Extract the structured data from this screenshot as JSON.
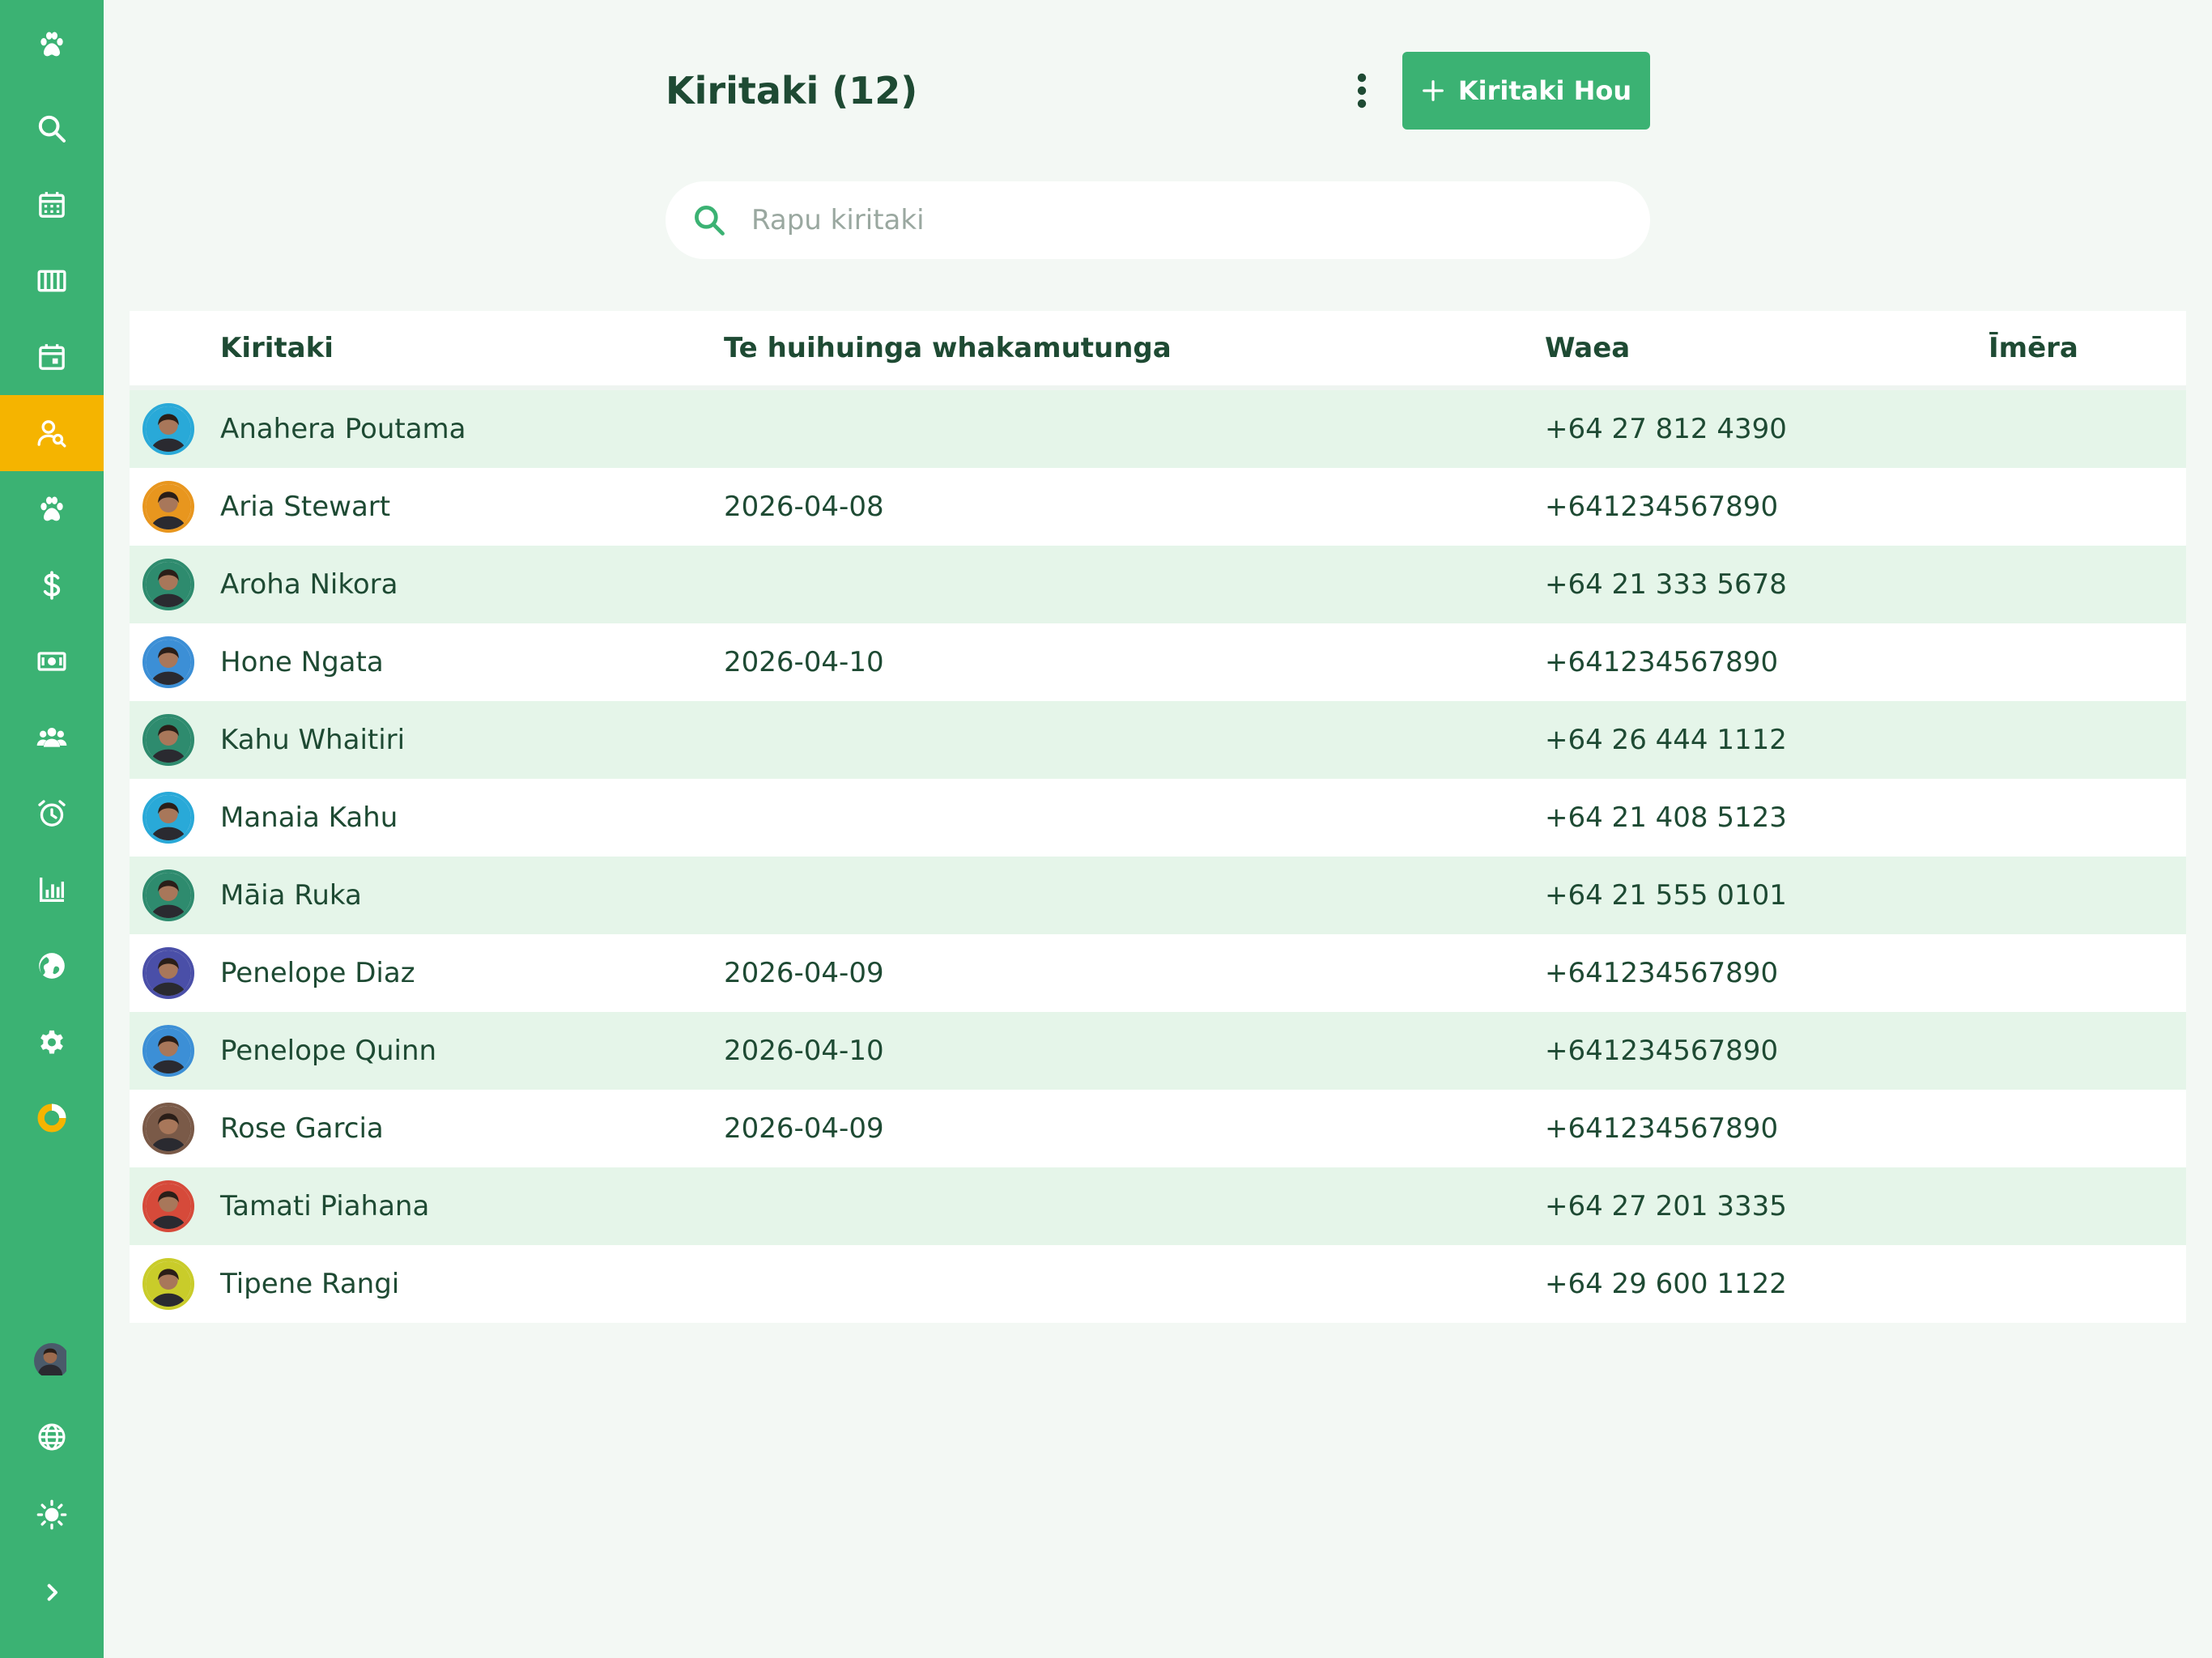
{
  "sidebar": {
    "items": [
      {
        "icon": "paw-icon"
      },
      {
        "icon": "search-icon"
      },
      {
        "icon": "calendar-grid-icon"
      },
      {
        "icon": "columns-icon"
      },
      {
        "icon": "calendar-day-icon"
      },
      {
        "icon": "user-search-icon",
        "active": true
      },
      {
        "icon": "paw-icon"
      },
      {
        "icon": "dollar-icon"
      },
      {
        "icon": "cash-icon"
      },
      {
        "icon": "group-icon"
      },
      {
        "icon": "alarm-icon"
      },
      {
        "icon": "bar-chart-icon"
      },
      {
        "icon": "globe-filled-icon"
      },
      {
        "icon": "gear-icon"
      },
      {
        "icon": "donut-icon"
      }
    ],
    "bottom": [
      {
        "icon": "user-avatar"
      },
      {
        "icon": "language-globe-icon"
      },
      {
        "icon": "sun-icon"
      },
      {
        "icon": "chevron-right-icon"
      }
    ],
    "colors": {
      "background": "#3bb273",
      "active": "#f5b400"
    }
  },
  "header": {
    "title": "Kiritaki (12)",
    "add_button_label": "Kiritaki Hou"
  },
  "search": {
    "placeholder": "Rapu kiritaki",
    "value": ""
  },
  "table": {
    "columns": {
      "name": "Kiritaki",
      "last_appointment": "Te huihuinga whakamutunga",
      "phone": "Waea",
      "email": "Īmēra"
    },
    "rows": [
      {
        "name": "Anahera Poutama",
        "last_appointment": "",
        "phone": "+64 27 812 4390",
        "email": "",
        "avatar_color": "#29a9d8"
      },
      {
        "name": "Aria Stewart",
        "last_appointment": "2026-04-08",
        "phone": "+641234567890",
        "email": "",
        "avatar_color": "#e8961e"
      },
      {
        "name": "Aroha Nikora",
        "last_appointment": "",
        "phone": "+64 21 333 5678",
        "email": "",
        "avatar_color": "#2e8b6e"
      },
      {
        "name": "Hone Ngata",
        "last_appointment": "2026-04-10",
        "phone": "+641234567890",
        "email": "",
        "avatar_color": "#3c8fd6"
      },
      {
        "name": "Kahu Whaitiri",
        "last_appointment": "",
        "phone": "+64 26 444 1112",
        "email": "",
        "avatar_color": "#2e8b6e"
      },
      {
        "name": "Manaia Kahu",
        "last_appointment": "",
        "phone": "+64 21 408 5123",
        "email": "",
        "avatar_color": "#29a9d8"
      },
      {
        "name": "Māia Ruka",
        "last_appointment": "",
        "phone": "+64 21 555 0101",
        "email": "",
        "avatar_color": "#2e8b6e"
      },
      {
        "name": "Penelope Diaz",
        "last_appointment": "2026-04-09",
        "phone": "+641234567890",
        "email": "",
        "avatar_color": "#4a4fa8"
      },
      {
        "name": "Penelope Quinn",
        "last_appointment": "2026-04-10",
        "phone": "+641234567890",
        "email": "",
        "avatar_color": "#3c8fd6"
      },
      {
        "name": "Rose Garcia",
        "last_appointment": "2026-04-09",
        "phone": "+641234567890",
        "email": "",
        "avatar_color": "#7a5a48"
      },
      {
        "name": "Tamati Piahana",
        "last_appointment": "",
        "phone": "+64 27 201 3335",
        "email": "",
        "avatar_color": "#d64a3a"
      },
      {
        "name": "Tipene Rangi",
        "last_appointment": "",
        "phone": "+64 29 600 1122",
        "email": "",
        "avatar_color": "#c9cc2a"
      }
    ]
  },
  "colors": {
    "accent": "#3bb273",
    "text": "#1e4a33",
    "row_alt": "#e5f5e9",
    "page_background": "#f3f8f4"
  }
}
